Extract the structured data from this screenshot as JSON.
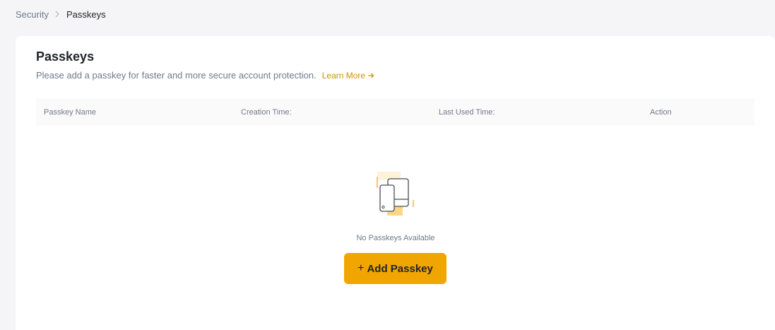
{
  "breadcrumb": {
    "parent": "Security",
    "current": "Passkeys"
  },
  "card": {
    "title": "Passkeys",
    "description": "Please add a passkey for faster and more secure account protection.",
    "learn_more": "Learn More"
  },
  "table": {
    "columns": [
      "Passkey Name",
      "Creation Time:",
      "Last Used Time:",
      "Action"
    ]
  },
  "empty_state": {
    "text": "No Passkeys Available",
    "icon": "devices-icon"
  },
  "add_button": {
    "plus": "+",
    "label": "Add Passkey"
  },
  "colors": {
    "accent": "#F0A500",
    "link": "#C99400",
    "text_primary": "#1E2329",
    "text_secondary": "#707A8A",
    "page_bg": "#F5F5F7"
  }
}
